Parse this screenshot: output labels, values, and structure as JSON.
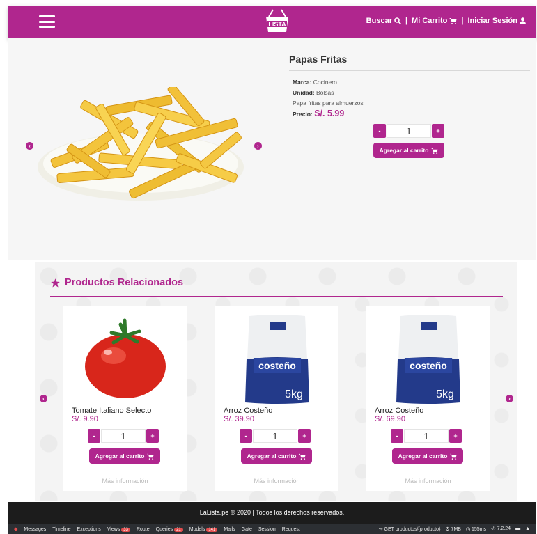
{
  "navbar": {
    "logo_text": "LISTA",
    "search_label": "Buscar",
    "cart_label": "Mi Carrito",
    "login_label": "Iniciar Sesión",
    "separator": "|",
    "brand_color": "#b0268e"
  },
  "product": {
    "title": "Papas Fritas",
    "brand_label": "Marca:",
    "brand_value": "Cocinero",
    "unit_label": "Unidad:",
    "unit_value": "Bolsas",
    "description": "Papa fritas para almuerzos",
    "price_label": "Precio:",
    "price": "S/. 5.99",
    "quantity": "1",
    "add_to_cart": "Agregar al carrito",
    "minus": "-",
    "plus": "+"
  },
  "related": {
    "title": "Productos Relacionados",
    "items": [
      {
        "name": "Tomate Italiano Selecto",
        "price": "S/. 9.90",
        "quantity": "1",
        "add_to_cart": "Agregar al carrito",
        "more": "Más información",
        "image": "tomato"
      },
      {
        "name": "Arroz Costeño",
        "price": "S/. 39.90",
        "quantity": "1",
        "add_to_cart": "Agregar al carrito",
        "more": "Más información",
        "image": "rice-bag"
      },
      {
        "name": "Arroz Costeño",
        "price": "S/. 69.90",
        "quantity": "1",
        "add_to_cart": "Agregar al carrito",
        "more": "Más información",
        "image": "rice-bag"
      }
    ],
    "rice_brand": "costeño",
    "rice_weight": "5kg"
  },
  "footer": {
    "text": "LaLista.pe © 2020 | Todos los derechos reservados."
  },
  "debugbar": {
    "items": [
      "Messages",
      "Timeline",
      "Exceptions",
      "Views",
      "Route",
      "Queries",
      "Models",
      "Mails",
      "Gate",
      "Session",
      "Request"
    ],
    "views_count": "33",
    "queries_count": "21",
    "models_count": "141",
    "route": "GET productos/{producto}",
    "memory": "7MB",
    "time": "155ms",
    "php": "7.2.24"
  }
}
